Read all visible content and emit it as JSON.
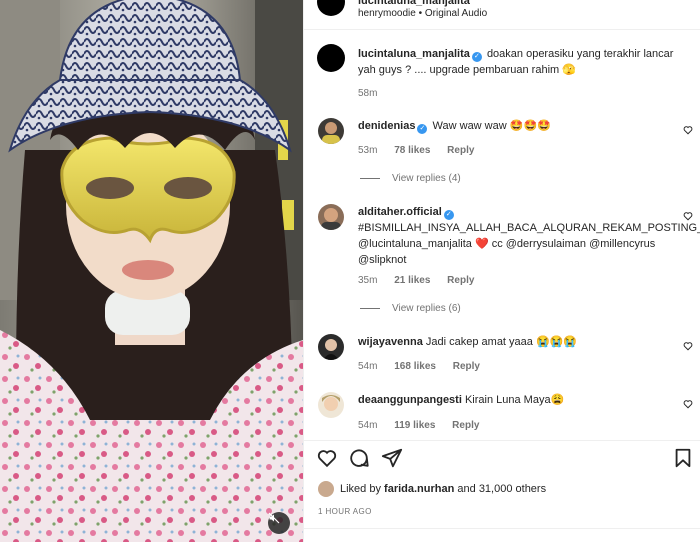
{
  "post_header": {
    "username": "lucintaluna_manjalita",
    "audio": "henrymoodie • Original Audio"
  },
  "caption": {
    "username": "lucintaluna_manjalita",
    "text": "doakan operasiku yang terakhir lancar yah guys ? .... upgrade pembaruan rahim 🫣",
    "time": "58m"
  },
  "comments": [
    {
      "username": "denidenias",
      "verified": true,
      "text": "Waw waw waw 🤩🤩🤩",
      "time": "53m",
      "likes": "78 likes",
      "reply_label": "Reply",
      "view_replies": "View replies (4)"
    },
    {
      "username": "alditaher.official",
      "verified": true,
      "text": "#BISMILLAH_INSYA_ALLAH_BACA_ALQURAN_REKAM_POSTING_JUGA @lucintaluna_manjalita ❤️ cc @derrysulaiman @millencyrus @slipknot",
      "time": "35m",
      "likes": "21 likes",
      "reply_label": "Reply",
      "view_replies": "View replies (6)"
    },
    {
      "username": "wijayavenna",
      "verified": false,
      "text": "Jadi cakep amat yaaa 😭😭😭",
      "time": "54m",
      "likes": "168 likes",
      "reply_label": "Reply"
    },
    {
      "username": "deaanggunpangesti",
      "verified": false,
      "text": "Kirain Luna Maya😩",
      "time": "54m",
      "likes": "119 likes",
      "reply_label": "Reply"
    }
  ],
  "likes_summary": {
    "prefix": "Liked by",
    "user": "farida.nurhan",
    "suffix": "and 31,000 others"
  },
  "posted_ago": "1 HOUR AGO",
  "icons": {
    "like": "heart-icon",
    "comment": "comment-icon",
    "share": "share-icon",
    "save": "bookmark-icon",
    "mute": "speaker-muted-icon"
  },
  "colors": {
    "verified": "#3797f0",
    "text": "#262626",
    "muted": "#737373"
  }
}
